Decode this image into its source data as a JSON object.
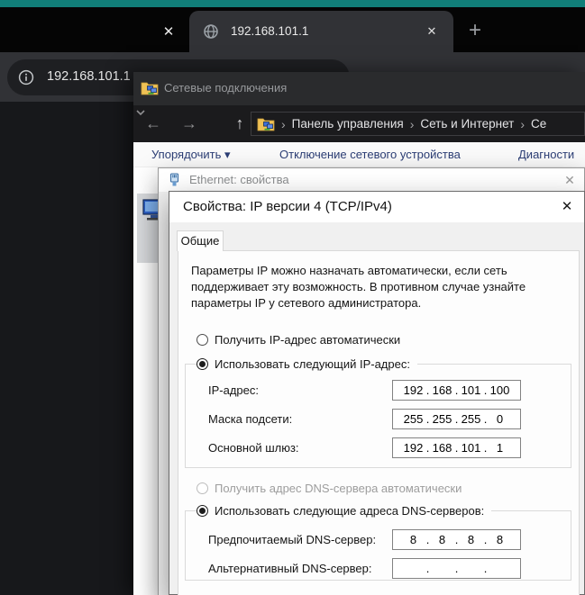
{
  "colors": {
    "accent_teal": "#117e79",
    "command_link_blue": "#2c3e75",
    "selection_gray": "#d7d9dc"
  },
  "icons": {
    "close": "✕",
    "new_tab": "+",
    "back": "←",
    "forward": "→",
    "up": "↑",
    "crumb_separator": "›",
    "dropdown_arrow": "▾"
  },
  "browser": {
    "active_tab": {
      "title": "192.168.101.1"
    },
    "address_bar": {
      "value": "192.168.101.1"
    }
  },
  "explorer": {
    "window_title": "Сетевые подключения",
    "breadcrumbs": [
      "Панель управления",
      "Сеть и Интернет",
      "Се"
    ],
    "command_bar": {
      "organize": "Упорядочить",
      "disable_device": "Отключение сетевого устройства",
      "diagnose": "Диагности"
    }
  },
  "ethernet_dialog": {
    "title": "Ethernet: свойства"
  },
  "ipv4_dialog": {
    "title": "Свойства: IP версии 4 (TCP/IPv4)",
    "tab_general": "Общие",
    "intro_lines": [
      "Параметры IP можно назначать автоматически, если сеть",
      "поддерживает эту возможность. В противном случае узнайте",
      "параметры IP у сетевого администратора."
    ],
    "radio_ip_auto": "Получить IP-адрес автоматически",
    "radio_ip_manual": "Использовать следующий IP-адрес:",
    "radio_dns_auto": "Получить адрес DNS-сервера автоматически",
    "radio_dns_manual": "Использовать следующие адреса DNS-серверов:",
    "fields": {
      "ip": {
        "label": "IP-адрес:",
        "octets": [
          "192",
          "168",
          "101",
          "100"
        ]
      },
      "mask": {
        "label": "Маска подсети:",
        "octets": [
          "255",
          "255",
          "255",
          "0"
        ]
      },
      "gateway": {
        "label": "Основной шлюз:",
        "octets": [
          "192",
          "168",
          "101",
          "1"
        ]
      },
      "dns_primary": {
        "label": "Предпочитаемый DNS-сервер:",
        "octets": [
          "8",
          "8",
          "8",
          "8"
        ]
      },
      "dns_alt": {
        "label": "Альтернативный DNS-сервер:",
        "octets": [
          "",
          "",
          "",
          ""
        ]
      }
    }
  }
}
